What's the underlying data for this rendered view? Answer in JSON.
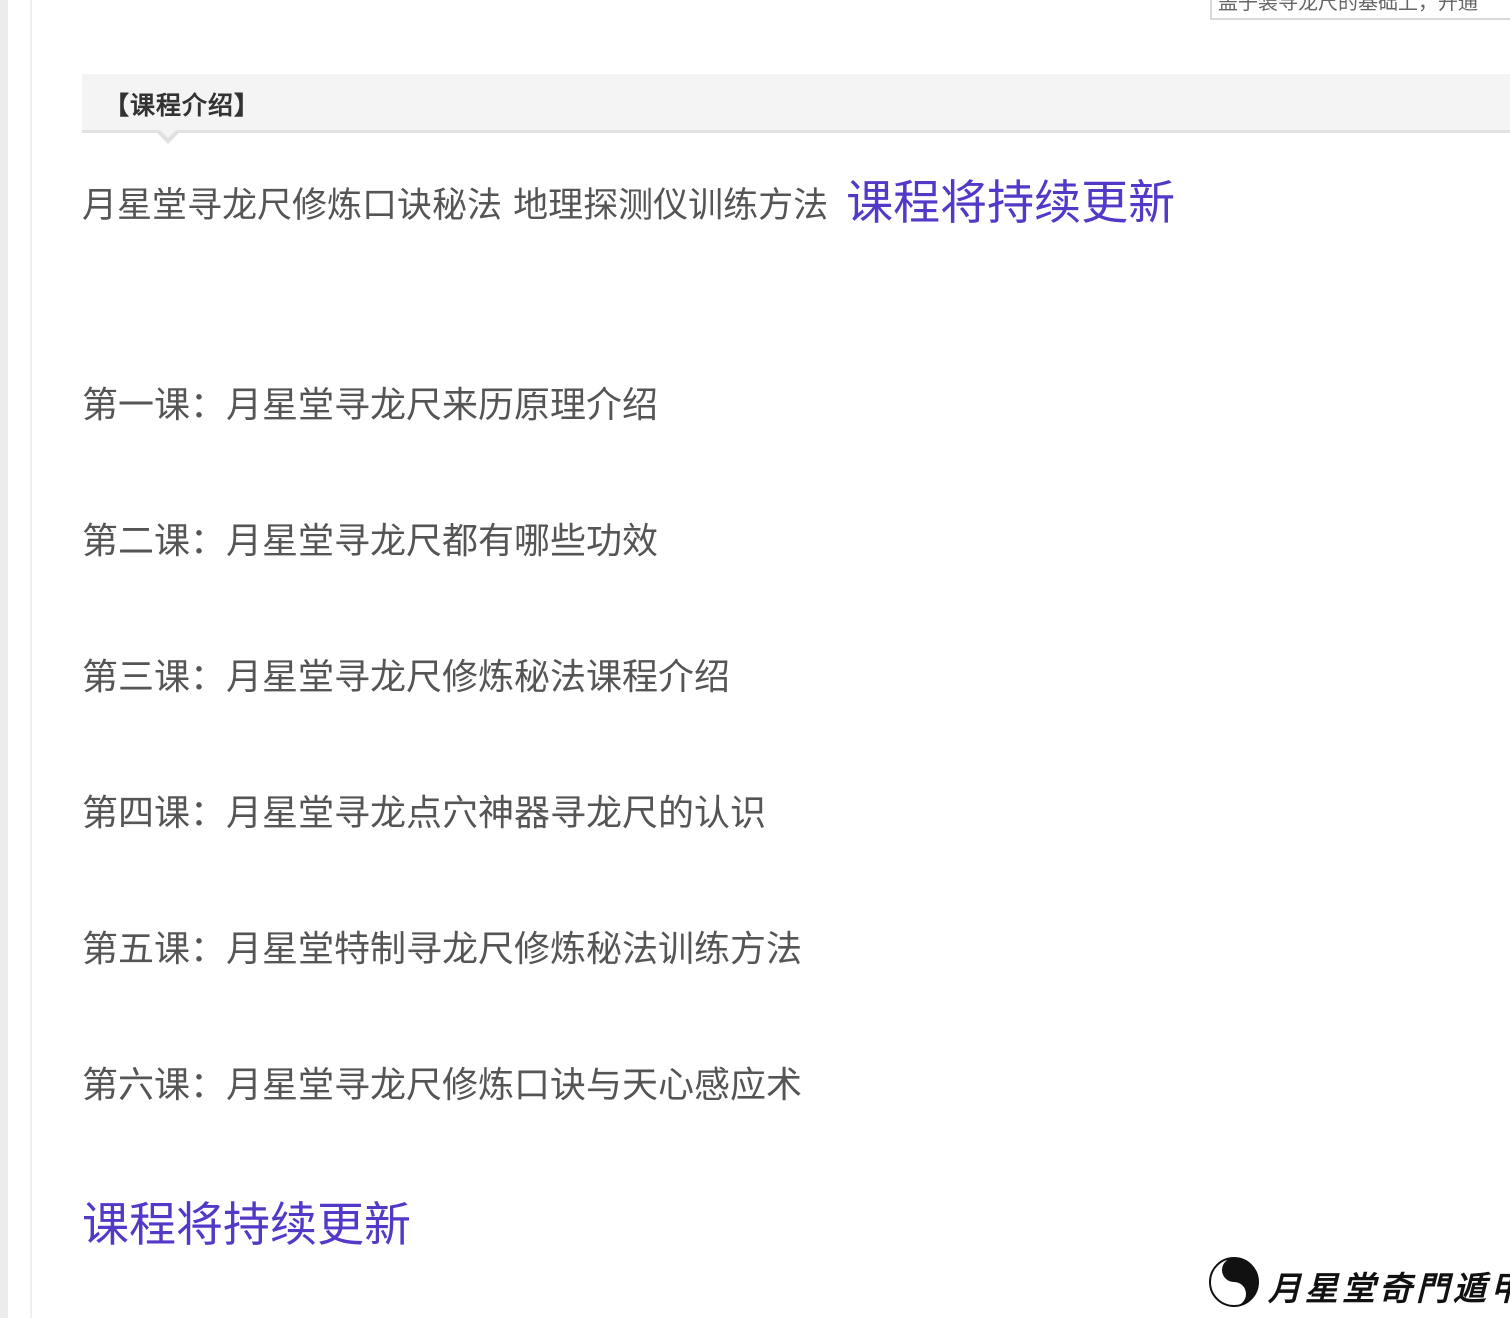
{
  "top_clip": {
    "text": "盖子装寻龙尺的基础上，开通"
  },
  "section": {
    "title": "【课程介绍】"
  },
  "intro": {
    "text": "月星堂寻龙尺修炼口诀秘法 地理探测仪训练方法",
    "update": "课程将持续更新"
  },
  "lessons": [
    "第一课：月星堂寻龙尺来历原理介绍",
    "第二课：月星堂寻龙尺都有哪些功效",
    "第三课：月星堂寻龙尺修炼秘法课程介绍",
    "第四课：月星堂寻龙点穴神器寻龙尺的认识",
    "第五课：月星堂特制寻龙尺修炼秘法训练方法",
    "第六课：月星堂寻龙尺修炼口诀与天心感应术"
  ],
  "footer": {
    "update": "课程将持续更新"
  },
  "watermark": {
    "text": "月星堂奇門遁甲",
    "icon": "yin-yang-icon"
  },
  "colors": {
    "accent": "#5438c7",
    "body_text": "#555555",
    "header_bg": "#f4f4f4"
  }
}
